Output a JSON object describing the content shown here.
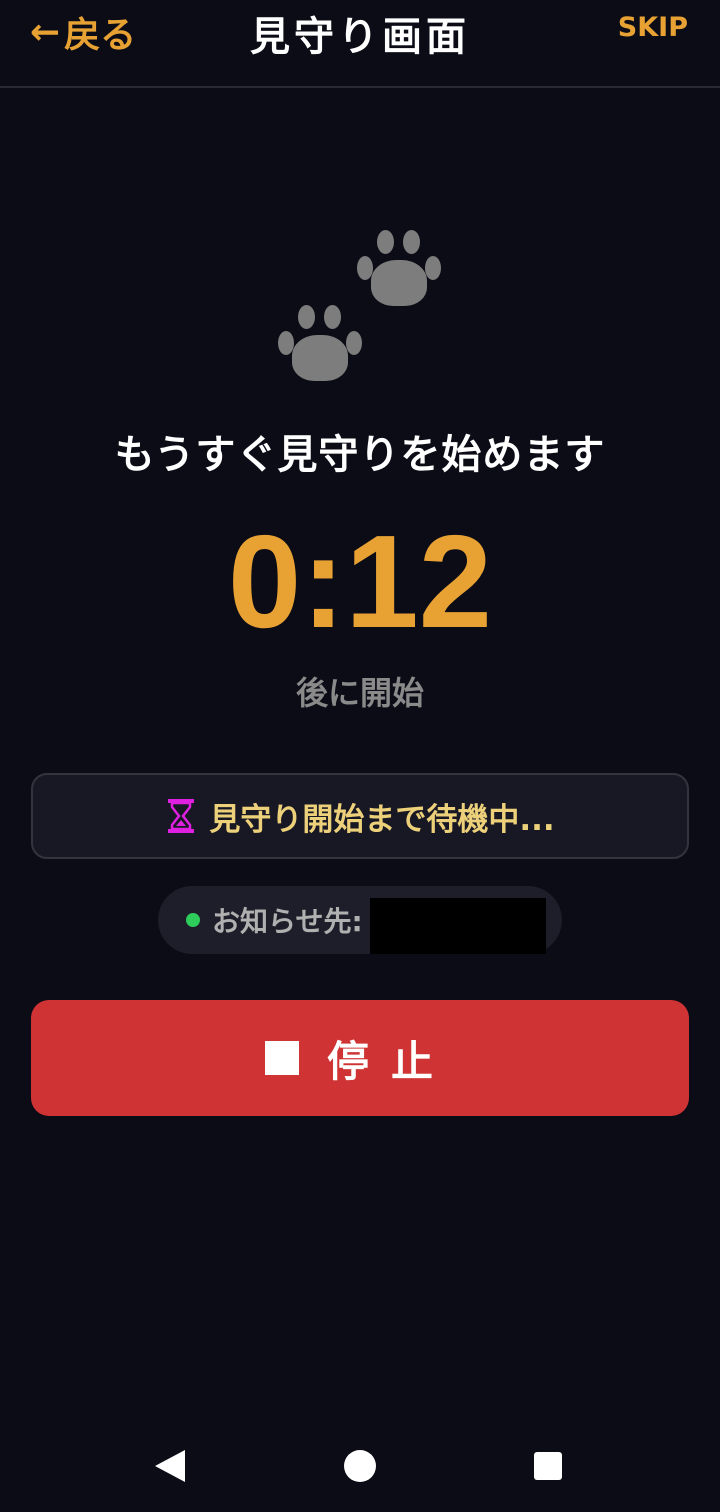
{
  "header": {
    "back_arrow": "←",
    "back_label": "戻る",
    "title": "見守り画面",
    "skip_label": "SKIP"
  },
  "main": {
    "headline": "もうすぐ見守りを始めます",
    "countdown": "0:12",
    "countdown_sub": "後に開始",
    "status_icon": "hourglass-icon",
    "status_text": "見守り開始まで待機中...",
    "notify_label": "お知らせ先:",
    "stop_label": "停止"
  },
  "colors": {
    "accent": "#e8a233",
    "background": "#0c0c17",
    "stop_button": "#cf3333",
    "status_text": "#ecd07a",
    "online_dot": "#2ecc5a",
    "hourglass": "#e020e0"
  },
  "navbar": {
    "icons": [
      "nav-back-icon",
      "nav-home-icon",
      "nav-recents-icon"
    ]
  }
}
